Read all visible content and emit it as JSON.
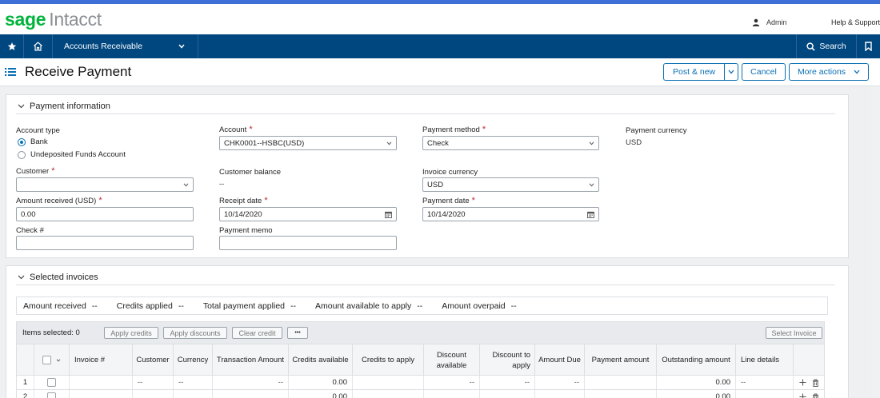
{
  "brand": {
    "sage": "sage",
    "product": "Intacct"
  },
  "header": {
    "user_label": "Admin",
    "help_label": "Help & Support"
  },
  "nav": {
    "module": "Accounts Receivable",
    "search": "Search"
  },
  "page": {
    "title": "Receive Payment"
  },
  "actions": {
    "post_new": "Post & new",
    "cancel": "Cancel",
    "more_actions": "More actions"
  },
  "payment_info": {
    "section_title": "Payment information",
    "account_type_label": "Account type",
    "account_type_options": [
      "Bank",
      "Undeposited Funds Account"
    ],
    "account_type_selected": "Bank",
    "account_label": "Account",
    "account_value": "CHK0001--HSBC(USD)",
    "payment_method_label": "Payment method",
    "payment_method_value": "Check",
    "payment_currency_label": "Payment currency",
    "payment_currency_value": "USD",
    "customer_label": "Customer",
    "customer_value": "",
    "customer_balance_label": "Customer balance",
    "customer_balance_value": "--",
    "invoice_currency_label": "Invoice currency",
    "invoice_currency_value": "USD",
    "amount_received_label": "Amount received (USD)",
    "amount_received_value": "0.00",
    "receipt_date_label": "Receipt date",
    "receipt_date_value": "10/14/2020",
    "payment_date_label": "Payment date",
    "payment_date_value": "10/14/2020",
    "check_label": "Check #",
    "check_value": "",
    "memo_label": "Payment memo",
    "memo_value": "",
    "required_mark": "*"
  },
  "selected_invoices": {
    "section_title": "Selected invoices",
    "summary": [
      {
        "label": "Amount received",
        "value": "--"
      },
      {
        "label": "Credits applied",
        "value": "--"
      },
      {
        "label": "Total payment applied",
        "value": "--"
      },
      {
        "label": "Amount available to apply",
        "value": "--"
      },
      {
        "label": "Amount overpaid",
        "value": "--"
      }
    ],
    "items_selected": "Items selected: 0",
    "buttons": {
      "apply_credits": "Apply credits",
      "apply_discounts": "Apply discounts",
      "clear_credit": "Clear credit",
      "more": "•••",
      "select_invoice": "Select Invoice"
    },
    "columns": [
      "Invoice #",
      "Customer",
      "Currency",
      "Transaction Amount",
      "Credits available",
      "Credits to apply",
      "Discount available",
      "Discount to apply",
      "Amount Due",
      "Payment amount",
      "Outstanding amount",
      "Line details"
    ],
    "rows": [
      {
        "num": "1",
        "invoice": "",
        "customer": "--",
        "currency": "--",
        "transaction_amount": "--",
        "credits_available": "0.00",
        "credits_to_apply": "",
        "discount_available": "--",
        "discount_to_apply": "--",
        "amount_due": "--",
        "payment_amount": "",
        "outstanding_amount": "0.00",
        "line_details": "--"
      },
      {
        "num": "2",
        "invoice": "",
        "customer": "",
        "currency": "",
        "transaction_amount": "",
        "credits_available": "0.00",
        "credits_to_apply": "",
        "discount_available": "",
        "discount_to_apply": "",
        "amount_due": "",
        "payment_amount": "",
        "outstanding_amount": "0.00",
        "line_details": ""
      }
    ]
  }
}
